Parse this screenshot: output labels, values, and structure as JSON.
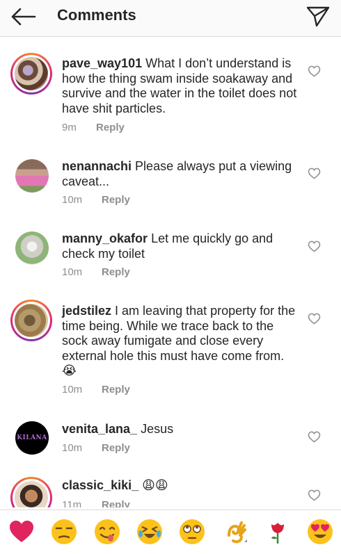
{
  "header": {
    "title": "Comments",
    "back_icon": "arrow-left-icon",
    "send_icon": "paper-plane-icon"
  },
  "comments": [
    {
      "username": "pave_way101",
      "text": "What I don’t understand is how the thing swam inside soakaway and survive and the water in the toilet does not have shit particles.",
      "time": "9m",
      "reply": "Reply"
    },
    {
      "username": "nenannachi",
      "text": "Please always put a viewing caveat...",
      "time": "10m",
      "reply": "Reply"
    },
    {
      "username": "manny_okafor",
      "text": "Let me quickly go and check my toilet",
      "time": "10m",
      "reply": "Reply"
    },
    {
      "username": "jedstilez",
      "text": "I am leaving that property for the time being. While we trace back to the sock away fumigate and close every external hole this must have come from. 😭",
      "time": "10m",
      "reply": "Reply"
    },
    {
      "username": "venita_lana_",
      "text": "Jesus",
      "time": "10m",
      "reply": "Reply",
      "avatar_text": "KILANA"
    },
    {
      "username": "classic_kiki_",
      "text": "😩😩",
      "time": "11m",
      "reply": "Reply"
    }
  ],
  "emoji_bar": {
    "items": [
      "red-heart",
      "unamused-face",
      "face-savoring-food",
      "rolling-on-floor-laughing",
      "face-with-rolling-eyes",
      "ok-hand",
      "rose",
      "heart-eyes"
    ]
  },
  "colors": {
    "accent_ring": "#dd2a7b",
    "muted": "#8e8e8e",
    "text": "#262626"
  }
}
